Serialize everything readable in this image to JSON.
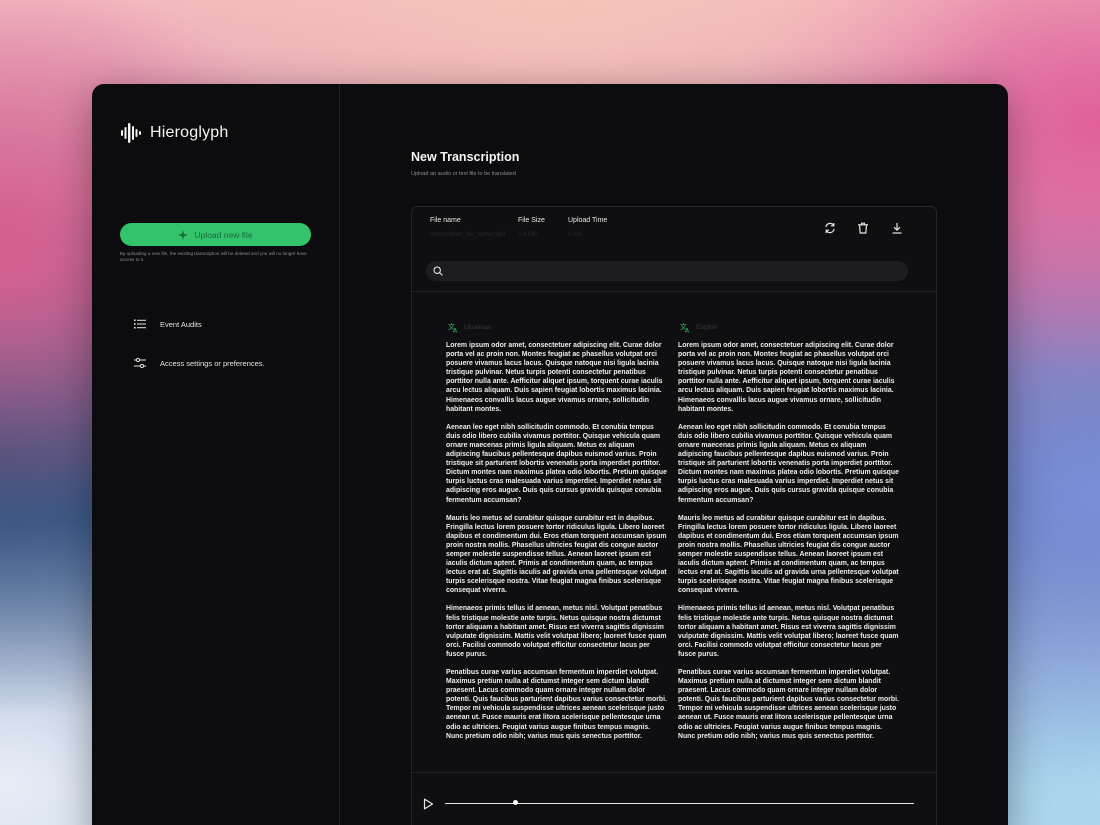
{
  "brand": {
    "name": "Hieroglyph"
  },
  "sidebar": {
    "upload_label": "Upload new file",
    "upload_note": "By uploading a new file, the existing transcription will be deleted and you will no longer have access to it.",
    "items": [
      {
        "label": "Event Audits",
        "icon": "list-icon"
      },
      {
        "label": "Access settings or preferences.",
        "icon": "sliders-icon"
      }
    ]
  },
  "header": {
    "title": "New Transcription",
    "subtitle": "Upload an audio or text file to be translated"
  },
  "file_table": {
    "headers": [
      "File name",
      "File Size",
      "Upload Time"
    ],
    "values": [
      "transcription_file_name.mp3",
      "2.4 MB",
      "2 min"
    ]
  },
  "toolbar": {
    "icons": [
      "refresh-icon",
      "trash-icon",
      "download-icon"
    ]
  },
  "search": {
    "placeholder": ""
  },
  "transcript": {
    "source": {
      "language": "Ukrainian",
      "paragraphs": [
        "Lorem ipsum odor amet, consectetuer adipiscing elit. Curae dolor porta vel ac proin non. Montes feugiat ac phasellus volutpat orci posuere vivamus lacus lacus. Quisque natoque nisi ligula lacinia tristique pulvinar. Netus turpis potenti consectetur penatibus porttitor nulla ante. Aefficitur aliquet ipsum, torquent curae iaculis arcu lectus aliquam. Duis sapien feugiat lobortis maximus lacinia. Himenaeos convallis lacus augue vivamus ornare, sollicitudin habitant montes.",
        "Aenean leo eget nibh sollicitudin commodo. Et conubia tempus duis odio libero cubilia vivamus porttitor. Quisque vehicula quam ornare maecenas primis ligula aliquam. Metus ex aliquam adipiscing faucibus pellentesque dapibus euismod varius. Proin tristique sit parturient lobortis venenatis porta imperdiet porttitor. Dictum montes nam maximus platea odio lobortis. Pretium quisque turpis luctus cras malesuada varius imperdiet. Imperdiet netus sit adipiscing eros augue. Duis quis cursus gravida quisque conubia fermentum accumsan?",
        "Mauris leo metus ad curabitur quisque curabitur est in dapibus. Fringilla lectus lorem posuere tortor ridiculus ligula. Libero laoreet dapibus et condimentum dui. Eros etiam torquent accumsan ipsum proin nostra mollis. Phasellus ultricies feugiat dis congue auctor semper molestie suspendisse tellus. Aenean laoreet ipsum est iaculis dictum aptent. Primis at condimentum quam, ac tempus lectus erat at. Sagittis iaculis ad gravida urna pellentesque volutpat turpis scelerisque nostra. Vitae feugiat magna finibus scelerisque consequat viverra.",
        "Himenaeos primis tellus id aenean, metus nisl. Volutpat penatibus felis tristique molestie ante turpis. Netus quisque nostra dictumst tortor aliquam a habitant amet. Risus est viverra sagittis dignissim vulputate dignissim. Mattis velit volutpat libero; laoreet fusce quam orci. Facilisi commodo volutpat efficitur consectetur lacus per fusce purus.",
        "Penatibus curae varius accumsan fermentum imperdiet volutpat. Maximus pretium nulla at dictumst integer sem dictum blandit praesent. Lacus commodo quam ornare integer nullam dolor potenti. Quis faucibus parturient dapibus varius consectetur morbi. Tempor mi vehicula suspendisse ultrices aenean scelerisque justo aenean ut. Fusce mauris erat litora scelerisque pellentesque urna odio ac ultricies. Feugiat varius augue finibus tempus magnis. Nunc pretium odio nibh; varius mus quis senectus porttitor."
      ]
    },
    "target": {
      "language": "English",
      "paragraphs": [
        "Lorem ipsum odor amet, consectetuer adipiscing elit. Curae dolor porta vel ac proin non. Montes feugiat ac phasellus volutpat orci posuere vivamus lacus lacus. Quisque natoque nisi ligula lacinia tristique pulvinar. Netus turpis potenti consectetur penatibus porttitor nulla ante. Aefficitur aliquet ipsum, torquent curae iaculis arcu lectus aliquam. Duis sapien feugiat lobortis maximus lacinia. Himenaeos convallis lacus augue vivamus ornare, sollicitudin habitant montes.",
        "Aenean leo eget nibh sollicitudin commodo. Et conubia tempus duis odio libero cubilia vivamus porttitor. Quisque vehicula quam ornare maecenas primis ligula aliquam. Metus ex aliquam adipiscing faucibus pellentesque dapibus euismod varius. Proin tristique sit parturient lobortis venenatis porta imperdiet porttitor. Dictum montes nam maximus platea odio lobortis. Pretium quisque turpis luctus cras malesuada varius imperdiet. Imperdiet netus sit adipiscing eros augue. Duis quis cursus gravida quisque conubia fermentum accumsan?",
        "Mauris leo metus ad curabitur quisque curabitur est in dapibus. Fringilla lectus lorem posuere tortor ridiculus ligula. Libero laoreet dapibus et condimentum dui. Eros etiam torquent accumsan ipsum proin nostra mollis. Phasellus ultricies feugiat dis congue auctor semper molestie suspendisse tellus. Aenean laoreet ipsum est iaculis dictum aptent. Primis at condimentum quam, ac tempus lectus erat at. Sagittis iaculis ad gravida urna pellentesque volutpat turpis scelerisque nostra. Vitae feugiat magna finibus scelerisque consequat viverra.",
        "Himenaeos primis tellus id aenean, metus nisl. Volutpat penatibus felis tristique molestie ante turpis. Netus quisque nostra dictumst tortor aliquam a habitant amet. Risus est viverra sagittis dignissim vulputate dignissim. Mattis velit volutpat libero; laoreet fusce quam orci. Facilisi commodo volutpat efficitur consectetur lacus per fusce purus.",
        "Penatibus curae varius accumsan fermentum imperdiet volutpat. Maximus pretium nulla at dictumst integer sem dictum blandit praesent. Lacus commodo quam ornare integer nullam dolor potenti. Quis faucibus parturient dapibus varius consectetur morbi. Tempor mi vehicula suspendisse ultrices aenean scelerisque justo aenean ut. Fusce mauris erat litora scelerisque pellentesque urna odio ac ultricies. Feugiat varius augue finibus tempus magnis. Nunc pretium odio nibh; varius mus quis senectus porttitor."
      ]
    }
  },
  "player": {
    "progress": 0.15
  },
  "colors": {
    "accent": "#33c46b",
    "window_bg": "#0c0c0e",
    "panel_border": "#26262a"
  }
}
